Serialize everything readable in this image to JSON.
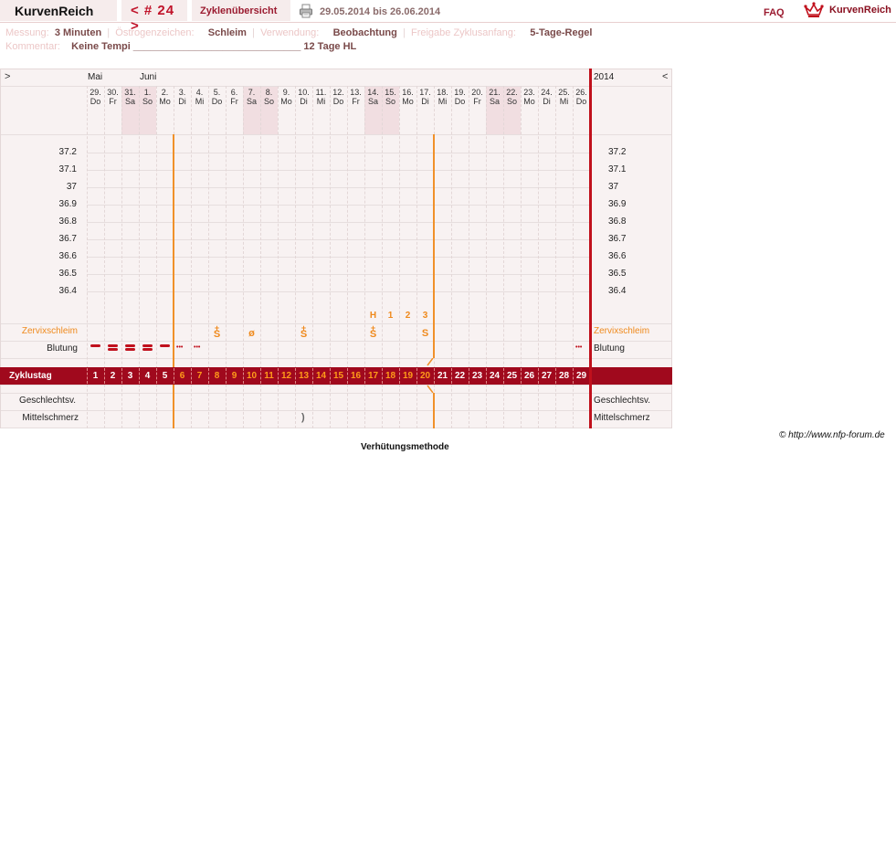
{
  "topbar": {
    "brand": "KurvenReich",
    "cycle": "< # 24 >",
    "overview_tab": "Zyklenübersicht",
    "date_range": "29.05.2014 bis 26.06.2014",
    "faq": "FAQ",
    "logo_text": "KurvenReich",
    "icons": [
      "printer-icon",
      "crown-logo-icon"
    ]
  },
  "info": {
    "messung_label": "Messung:",
    "messung_value": "3 Minuten",
    "oestrogen_label": "Östrogenzeichen:",
    "oestrogen_value": "Schleim",
    "verwendung_label": "Verwendung:",
    "verwendung_value": "Beobachtung",
    "freigabe_label": "Freigabe Zyklusanfang:",
    "freigabe_value": "5-Tage-Regel",
    "kommentar_label": "Kommentar:",
    "kommentar_value": "Keine Tempi ______________________________ 12 Tage HL"
  },
  "chart": {
    "nav_left": ">",
    "nav_right": "<",
    "year": "2014",
    "months": [
      "Mai",
      "Juni"
    ],
    "days": [
      {
        "d": "29.",
        "w": "Do"
      },
      {
        "d": "30.",
        "w": "Fr"
      },
      {
        "d": "31.",
        "w": "Sa"
      },
      {
        "d": "1.",
        "w": "So"
      },
      {
        "d": "2.",
        "w": "Mo"
      },
      {
        "d": "3.",
        "w": "Di"
      },
      {
        "d": "4.",
        "w": "Mi"
      },
      {
        "d": "5.",
        "w": "Do"
      },
      {
        "d": "6.",
        "w": "Fr"
      },
      {
        "d": "7.",
        "w": "Sa"
      },
      {
        "d": "8.",
        "w": "So"
      },
      {
        "d": "9.",
        "w": "Mo"
      },
      {
        "d": "10.",
        "w": "Di"
      },
      {
        "d": "11.",
        "w": "Mi"
      },
      {
        "d": "12.",
        "w": "Do"
      },
      {
        "d": "13.",
        "w": "Fr"
      },
      {
        "d": "14.",
        "w": "Sa"
      },
      {
        "d": "15.",
        "w": "So"
      },
      {
        "d": "16.",
        "w": "Mo"
      },
      {
        "d": "17.",
        "w": "Di"
      },
      {
        "d": "18.",
        "w": "Mi"
      },
      {
        "d": "19.",
        "w": "Do"
      },
      {
        "d": "20.",
        "w": "Fr"
      },
      {
        "d": "21.",
        "w": "Sa"
      },
      {
        "d": "22.",
        "w": "So"
      },
      {
        "d": "23.",
        "w": "Mo"
      },
      {
        "d": "24.",
        "w": "Di"
      },
      {
        "d": "25.",
        "w": "Mi"
      },
      {
        "d": "26.",
        "w": "Do"
      }
    ],
    "weekend_indices": [
      2,
      3,
      9,
      10,
      16,
      17,
      23,
      24
    ],
    "temperatures": [
      "37.2",
      "37.1",
      "37",
      "36.9",
      "36.8",
      "36.7",
      "36.6",
      "36.5",
      "36.4"
    ],
    "helper_labels": [
      {
        "day": 17,
        "text": "H"
      },
      {
        "day": 18,
        "text": "1"
      },
      {
        "day": 19,
        "text": "2"
      },
      {
        "day": 20,
        "text": "3"
      }
    ],
    "zervix_label": "Zervixschleim",
    "zervix_marks": [
      {
        "day": 8,
        "text": "S",
        "plus": "+"
      },
      {
        "day": 10,
        "text": "ø",
        "plus": ""
      },
      {
        "day": 13,
        "text": "S",
        "plus": "+"
      },
      {
        "day": 17,
        "text": "S",
        "plus": "+"
      },
      {
        "day": 20,
        "text": "S",
        "plus": ""
      }
    ],
    "blutung_label": "Blutung",
    "bleeding": [
      {
        "day": 1,
        "type": "single"
      },
      {
        "day": 2,
        "type": "double"
      },
      {
        "day": 3,
        "type": "double"
      },
      {
        "day": 4,
        "type": "double"
      },
      {
        "day": 5,
        "type": "single"
      },
      {
        "day": 6,
        "type": "spot"
      },
      {
        "day": 7,
        "type": "spot"
      },
      {
        "day": 29,
        "type": "spot"
      }
    ],
    "spot_glyph": "•••",
    "zyklustag_label": "Zyklustag",
    "cycle_days": [
      "1",
      "2",
      "3",
      "4",
      "5",
      "6",
      "7",
      "8",
      "9",
      "10",
      "11",
      "12",
      "13",
      "14",
      "15",
      "16",
      "17",
      "18",
      "19",
      "20",
      "21",
      "22",
      "23",
      "24",
      "25",
      "26",
      "27",
      "28",
      "29"
    ],
    "highlight_days_from": 6,
    "highlight_days_to": 20,
    "geschlechtsv_label": "Geschlechtsv.",
    "mittelschmerz_label": "Mittelschmerz",
    "mittelschmerz_marks": [
      {
        "day": 13,
        "text": ")"
      }
    ],
    "colors": {
      "accent": "#a0091d",
      "orange": "#f0912a",
      "red": "#c0101c",
      "weekend": "#f1dee1",
      "chart_bg": "#f8f2f2"
    }
  },
  "footer": {
    "copyright": "© http://www.nfp-forum.de",
    "method": "Verhütungsmethode"
  }
}
